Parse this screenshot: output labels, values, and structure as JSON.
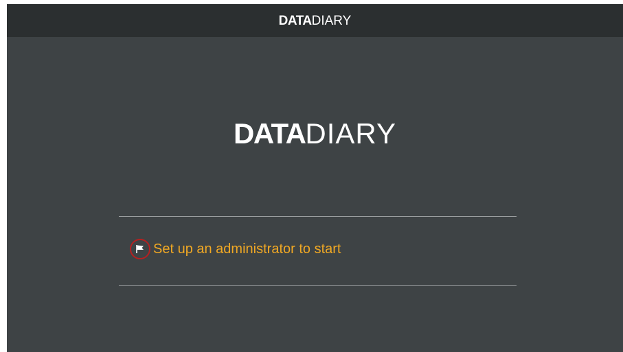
{
  "header": {
    "brand_bold": "DATA",
    "brand_light": "DIARY"
  },
  "hero": {
    "brand_bold": "DATA",
    "brand_light": "DIARY"
  },
  "setup": {
    "label": "Set up an administrator to start",
    "icon": "flag-icon",
    "accent_color": "#f0a824",
    "badge_color": "#b52020"
  }
}
